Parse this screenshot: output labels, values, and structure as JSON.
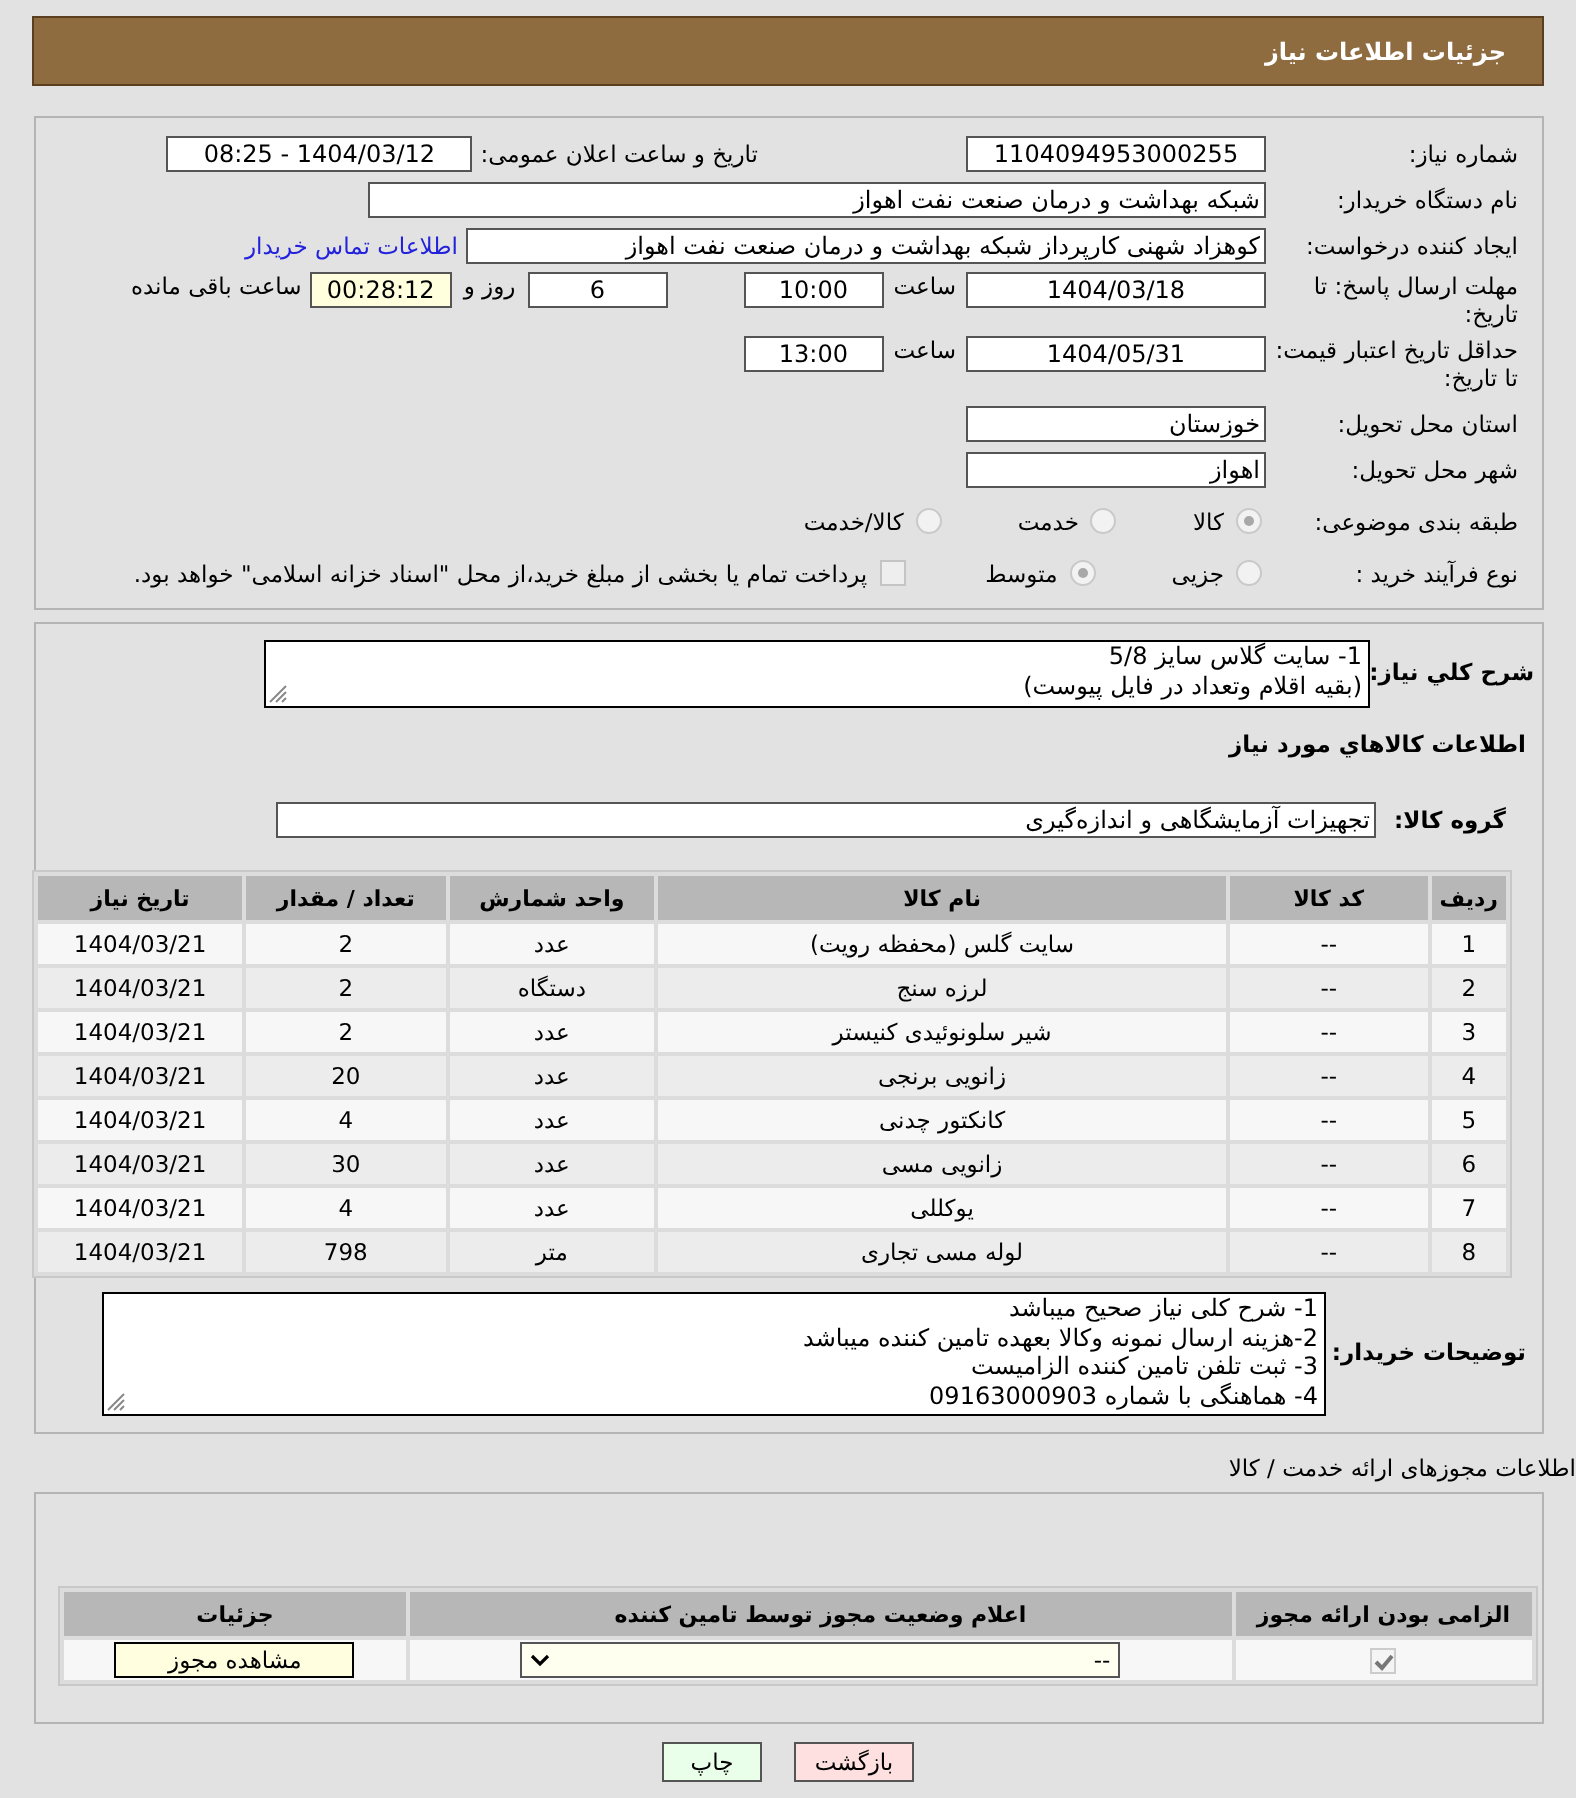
{
  "header": {
    "title": "جزئیات اطلاعات نیاز"
  },
  "details": {
    "need_number": {
      "label": "شماره نیاز:",
      "value": "1104094953000255"
    },
    "announce": {
      "label": "تاریخ و ساعت اعلان عمومی:",
      "value": "1404/03/12 - 08:25"
    },
    "buyer_org": {
      "label": "نام دستگاه خریدار:",
      "value": "شبکه بهداشت و درمان صنعت نفت اهواز"
    },
    "requester": {
      "label": "ایجاد کننده درخواست:",
      "value": "کوهزاد شهنی کارپرداز شبکه بهداشت و درمان صنعت نفت اهواز",
      "link": "اطلاعات تماس خریدار"
    },
    "reply_deadline": {
      "label": "مهلت ارسال پاسخ: تا تاریخ:",
      "date": "1404/03/18",
      "time_label": "ساعت",
      "time": "10:00",
      "days": "6",
      "days_label": "روز و",
      "remaining": "00:28:12",
      "remaining_label": "ساعت باقی مانده"
    },
    "price_validity": {
      "label": "حداقل تاریخ اعتبار قیمت: تا تاریخ:",
      "date": "1404/05/31",
      "time_label": "ساعت",
      "time": "13:00"
    },
    "province": {
      "label": "استان محل تحویل:",
      "value": "خوزستان"
    },
    "city": {
      "label": "شهر محل تحویل:",
      "value": "اهواز"
    },
    "category": {
      "label": "طبقه بندی موضوعی:",
      "options": [
        {
          "label": "کالا",
          "selected": true
        },
        {
          "label": "خدمت",
          "selected": false
        },
        {
          "label": "کالا/خدمت",
          "selected": false
        }
      ]
    },
    "process": {
      "label": "نوع فرآیند خرید :",
      "options": [
        {
          "label": "جزیی",
          "selected": false
        },
        {
          "label": "متوسط",
          "selected": true
        }
      ],
      "payment": {
        "checked": false,
        "label": "پرداخت تمام یا بخشی از مبلغ خرید،از محل \"اسناد خزانه اسلامی\" خواهد بود."
      }
    }
  },
  "description": {
    "label": "شرح كلي نياز:",
    "text": "1- سایت گلاس سایز 5/8\n(بقیه اقلام وتعداد در فایل پیوست)"
  },
  "items": {
    "title": "اطلاعات كالاهاي مورد نياز",
    "group_label": "گروه کالا:",
    "group": "تجهیزات آزمایشگاهی و اندازه‌گیری",
    "table": {
      "columns": [
        "ردیف",
        "کد کالا",
        "نام کالا",
        "واحد شمارش",
        "تعداد / مقدار",
        "تاریخ نیاز"
      ],
      "rows": [
        [
          "1",
          "--",
          "سایت گلس (محفظه رویت)",
          "عدد",
          "2",
          "1404/03/21"
        ],
        [
          "2",
          "--",
          "لرزه سنج",
          "دستگاه",
          "2",
          "1404/03/21"
        ],
        [
          "3",
          "--",
          "شیر سلونوئیدی کنیستر",
          "عدد",
          "2",
          "1404/03/21"
        ],
        [
          "4",
          "--",
          "زانویی برنجی",
          "عدد",
          "20",
          "1404/03/21"
        ],
        [
          "5",
          "--",
          "کانکتور چدنی",
          "عدد",
          "4",
          "1404/03/21"
        ],
        [
          "6",
          "--",
          "زانویی مسی",
          "عدد",
          "30",
          "1404/03/21"
        ],
        [
          "7",
          "--",
          "یوکللی",
          "عدد",
          "4",
          "1404/03/21"
        ],
        [
          "8",
          "--",
          "لوله مسی تجاری",
          "متر",
          "798",
          "1404/03/21"
        ]
      ]
    }
  },
  "buyer_notes": {
    "label": "توضیحات خریدار:",
    "text": "1- شرح کلی نیاز صحیح میباشد\n2-هزینه ارسال نمونه وکالا بعهده تامین کننده میباشد\n3- ثبت تلفن تامین کننده الزامیست\n4- هماهنگی با شماره 09163000903"
  },
  "permits": {
    "title": "اطلاعات مجوزهای ارائه خدمت / کالا",
    "columns": [
      "الزامی بودن ارائه مجوز",
      "اعلام وضعیت مجوز توسط تامین کننده",
      "جزئیات"
    ],
    "rows": [
      {
        "required": true,
        "status": "--",
        "details_button": "مشاهده مجوز"
      }
    ]
  },
  "buttons": [
    {
      "kind": "back",
      "label": "بازگشت"
    },
    {
      "kind": "print",
      "label": "چاپ"
    }
  ]
}
